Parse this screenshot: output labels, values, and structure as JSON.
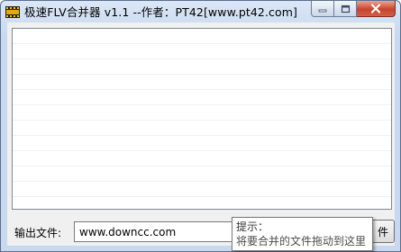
{
  "window": {
    "title": "极速FLV合并器 v1.1 --作者：PT42[www.pt42.com]"
  },
  "output": {
    "label": "输出文件:",
    "value": "www.downcc.com"
  },
  "browse_button": {
    "label": "件"
  },
  "tooltip": {
    "title": "提示：",
    "text": "将要合并的文件拖动到这里"
  },
  "icons": {
    "app": "film-icon",
    "minimize": "minimize-icon",
    "maximize": "maximize-icon",
    "close": "close-icon"
  },
  "colors": {
    "close_button": "#c8432b",
    "title_bar": "#dbe7f6"
  }
}
